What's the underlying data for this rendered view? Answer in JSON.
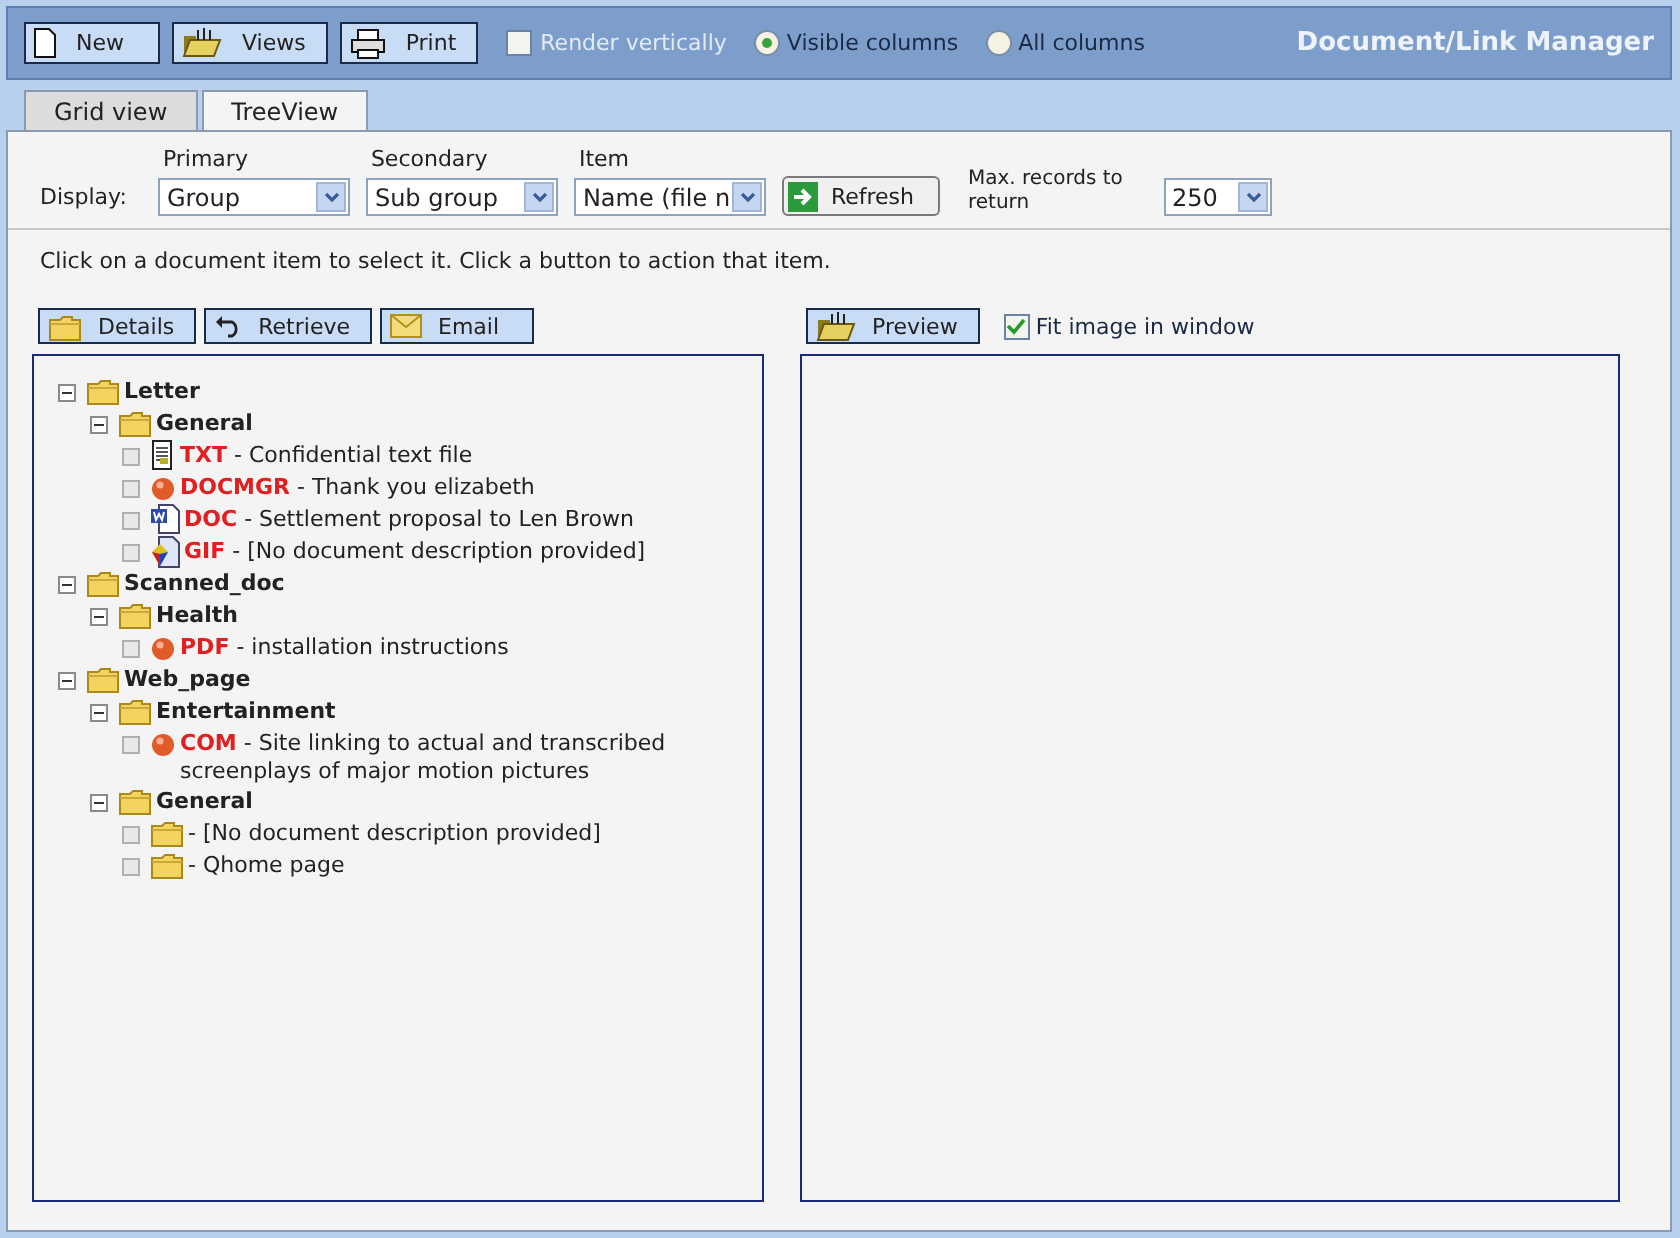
{
  "toolbar": {
    "buttons": [
      {
        "label": "New"
      },
      {
        "label": "Views"
      },
      {
        "label": "Print"
      }
    ],
    "render_vertically": {
      "label": "Render vertically",
      "checked": false
    },
    "column_options": [
      {
        "label": "Visible columns",
        "selected": true
      },
      {
        "label": "All columns",
        "selected": false
      }
    ],
    "title": "Document/Link Manager"
  },
  "tabs": [
    {
      "label": "Grid view",
      "selected": false
    },
    {
      "label": "TreeView",
      "selected": true
    }
  ],
  "display": {
    "label": "Display:",
    "selects": [
      {
        "caption": "Primary",
        "value": "Group"
      },
      {
        "caption": "Secondary",
        "value": "Sub group"
      },
      {
        "caption": "Item",
        "value": "Name (file n"
      }
    ],
    "refresh": "Refresh",
    "max_records_label": "Max. records to return",
    "max_records": "250"
  },
  "instructions": "Click on a document item to select it. Click a button to action that item.",
  "actions": [
    {
      "label": "Details"
    },
    {
      "label": "Retrieve"
    },
    {
      "label": "Email"
    }
  ],
  "preview": {
    "label": "Preview",
    "fit": {
      "label": "Fit image in window",
      "checked": true
    }
  },
  "tree": [
    {
      "kind": "group",
      "label": "Letter",
      "expanded": true,
      "children": [
        {
          "kind": "group",
          "label": "General",
          "expanded": true,
          "children": [
            {
              "kind": "text",
              "type": "TXT",
              "description": "- Confidential text file"
            },
            {
              "kind": "record",
              "type": "DOCMGR",
              "description": "- Thank you elizabeth"
            },
            {
              "kind": "word",
              "type": "DOC",
              "description": "- Settlement proposal to Len Brown"
            },
            {
              "kind": "image",
              "type": "GIF",
              "description": "- [No document description provided]"
            }
          ]
        }
      ]
    },
    {
      "kind": "group",
      "label": "Scanned_doc",
      "expanded": true,
      "children": [
        {
          "kind": "group",
          "label": "Health",
          "expanded": true,
          "children": [
            {
              "kind": "record",
              "type": "PDF",
              "description": "- installation instructions"
            }
          ]
        }
      ]
    },
    {
      "kind": "group",
      "label": "Web_page",
      "expanded": true,
      "children": [
        {
          "kind": "group",
          "label": "Entertainment",
          "expanded": true,
          "children": [
            {
              "kind": "record",
              "type": "COM",
              "description": "- Site linking to actual and transcribed screenplays of major motion pictures"
            }
          ]
        },
        {
          "kind": "group",
          "label": "General",
          "expanded": true,
          "children": [
            {
              "kind": "link",
              "description": "- [No document description provided]"
            },
            {
              "kind": "link",
              "description": "- Qhome page"
            }
          ]
        }
      ]
    }
  ]
}
